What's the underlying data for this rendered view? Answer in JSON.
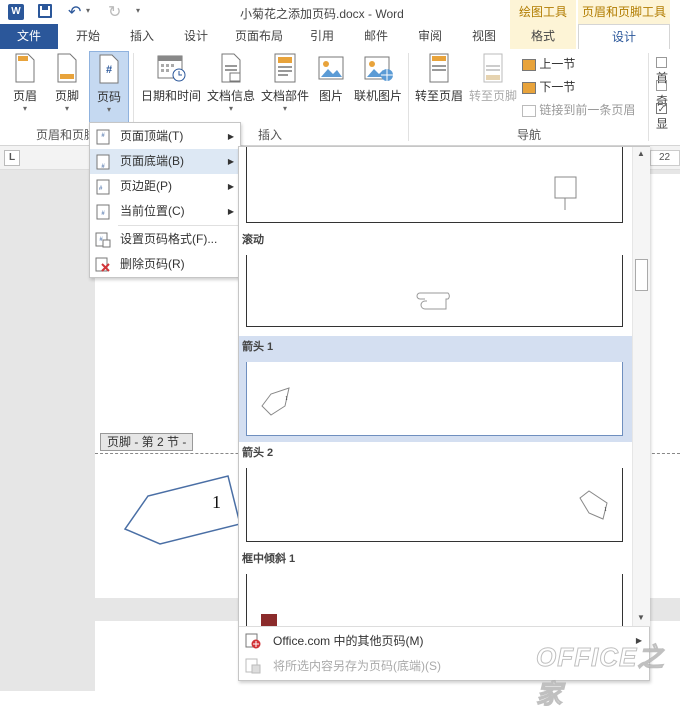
{
  "title": {
    "text": "小菊花之添加页码.docx - Word"
  },
  "contextual": {
    "drawing_tools": "绘图工具",
    "header_footer_tools": "页眉和页脚工具"
  },
  "tabs": [
    "文件",
    "开始",
    "插入",
    "设计",
    "页面布局",
    "引用",
    "邮件",
    "审阅",
    "视图",
    "格式",
    "设计"
  ],
  "ribbon": {
    "header": "页眉",
    "footer": "页脚",
    "page_number": "页码",
    "datetime": "日期和时间",
    "docinfo": "文档信息",
    "quickparts": "文档部件",
    "picture": "图片",
    "online_picture": "联机图片",
    "goto_header": "转至页眉",
    "goto_footer": "转至页脚",
    "prev_section": "上一节",
    "next_section": "下一节",
    "link_previous": "链接到前一条页眉",
    "group_hf": "页眉和页脚",
    "group_insert": "插入",
    "group_nav": "导航",
    "cut_a": "首",
    "cut_b": "奇",
    "cut_c": "显"
  },
  "ruler": {
    "left_marker": "L",
    "number": "22"
  },
  "menu": {
    "items": [
      "页面顶端(T)",
      "页面底端(B)",
      "页边距(P)",
      "当前位置(C)",
      "设置页码格式(F)...",
      "删除页码(R)"
    ]
  },
  "gallery": {
    "labels": [
      "滚动",
      "箭头 1",
      "箭头 2",
      "框中倾斜 1"
    ],
    "sample_digit": "1",
    "more": "Office.com 中的其他页码(M)",
    "save": "将所选内容另存为页码(底端)(S)"
  },
  "document": {
    "footer_tag": "页脚 - 第 2 节 -",
    "page_number": "1"
  },
  "watermark": "OFFICE之家",
  "colors": {
    "accent": "#2b579a",
    "contextual_bg": "#fdf4d6",
    "menu_highlight": "#dde8f4",
    "gallery_highlight": "#d4dff1"
  }
}
